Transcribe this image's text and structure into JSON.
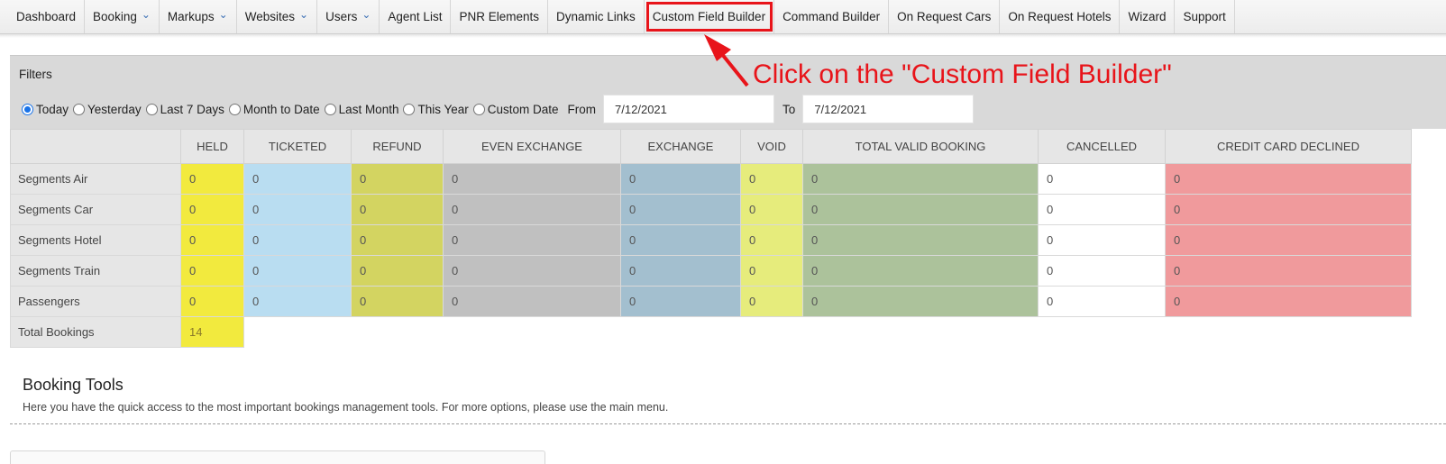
{
  "nav": {
    "items": [
      {
        "label": "Dashboard",
        "dropdown": false
      },
      {
        "label": "Booking",
        "dropdown": true
      },
      {
        "label": "Markups",
        "dropdown": true
      },
      {
        "label": "Websites",
        "dropdown": true
      },
      {
        "label": "Users",
        "dropdown": true
      },
      {
        "label": "Agent List",
        "dropdown": false
      },
      {
        "label": "PNR Elements",
        "dropdown": false
      },
      {
        "label": "Dynamic Links",
        "dropdown": false
      },
      {
        "label": "Custom Field Builder",
        "dropdown": false,
        "highlighted": true
      },
      {
        "label": "Command Builder",
        "dropdown": false
      },
      {
        "label": "On Request Cars",
        "dropdown": false
      },
      {
        "label": "On Request Hotels",
        "dropdown": false
      },
      {
        "label": "Wizard",
        "dropdown": false
      },
      {
        "label": "Support",
        "dropdown": false
      }
    ],
    "chevron_icon": "chevron-down-icon"
  },
  "annotation": {
    "text": "Click on the \"Custom Field Builder\"",
    "color": "#e8141a"
  },
  "filters": {
    "title": "Filters",
    "options": [
      {
        "label": "Today",
        "selected": true
      },
      {
        "label": "Yesterday",
        "selected": false
      },
      {
        "label": "Last 7 Days",
        "selected": false
      },
      {
        "label": "Month to Date",
        "selected": false
      },
      {
        "label": "Last Month",
        "selected": false
      },
      {
        "label": "This Year",
        "selected": false
      },
      {
        "label": "Custom Date",
        "selected": false
      }
    ],
    "from_label": "From",
    "from_value": "7/12/2021",
    "to_label": "To",
    "to_value": "7/12/2021"
  },
  "stats": {
    "columns": [
      {
        "label": "HELD",
        "color": "#f2ea3e"
      },
      {
        "label": "TICKETED",
        "color": "#b9ddf1"
      },
      {
        "label": "REFUND",
        "color": "#d3d461"
      },
      {
        "label": "EVEN EXCHANGE",
        "color": "#c0c0c0"
      },
      {
        "label": "EXCHANGE",
        "color": "#a3bfcf"
      },
      {
        "label": "VOID",
        "color": "#e6ec7c"
      },
      {
        "label": "TOTAL VALID BOOKING",
        "color": "#acc29b"
      },
      {
        "label": "CANCELLED",
        "color": "#ffffff"
      },
      {
        "label": "CREDIT CARD DECLINED",
        "color": "#f09a9c"
      }
    ],
    "rows": [
      {
        "label": "Segments Air",
        "values": [
          "0",
          "0",
          "0",
          "0",
          "0",
          "0",
          "0",
          "0",
          "0"
        ]
      },
      {
        "label": "Segments Car",
        "values": [
          "0",
          "0",
          "0",
          "0",
          "0",
          "0",
          "0",
          "0",
          "0"
        ]
      },
      {
        "label": "Segments Hotel",
        "values": [
          "0",
          "0",
          "0",
          "0",
          "0",
          "0",
          "0",
          "0",
          "0"
        ]
      },
      {
        "label": "Segments Train",
        "values": [
          "0",
          "0",
          "0",
          "0",
          "0",
          "0",
          "0",
          "0",
          "0"
        ]
      },
      {
        "label": "Passengers",
        "values": [
          "0",
          "0",
          "0",
          "0",
          "0",
          "0",
          "0",
          "0",
          "0"
        ]
      }
    ],
    "total": {
      "label": "Total Bookings",
      "value": "14"
    }
  },
  "tools": {
    "title": "Booking Tools",
    "description": "Here you have the quick access to the most important bookings management tools. For more options, please use the main menu."
  }
}
